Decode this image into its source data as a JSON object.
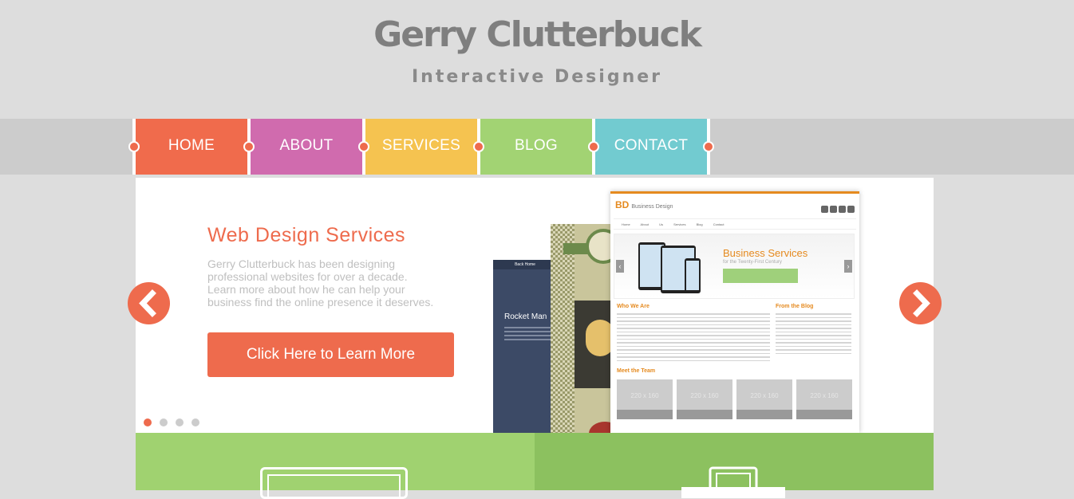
{
  "header": {
    "title": "Gerry Clutterbuck",
    "subtitle": "Interactive Designer"
  },
  "nav": {
    "items": [
      {
        "label": "HOME",
        "color": "#f06b4c"
      },
      {
        "label": "ABOUT",
        "color": "#d06bae"
      },
      {
        "label": "SERVICES",
        "color": "#f5c350"
      },
      {
        "label": "BLOG",
        "color": "#a2d373"
      },
      {
        "label": "CONTACT",
        "color": "#72cbd0"
      }
    ]
  },
  "slider": {
    "heading": "Web Design Services",
    "text": "Gerry Clutterbuck has been designing professional websites for over a decade. Learn more about how he can help your business find the online presence it deserves.",
    "cta_label": "Click Here to Learn More",
    "slide_count": 4,
    "active_slide": 1,
    "prev_icon": "chevron-left-icon",
    "next_icon": "chevron-right-icon",
    "mockup": {
      "left_header": "Back Home",
      "left_title": "Rocket Man",
      "site_logo": "BD",
      "site_name": "Business Design",
      "site_nav": "Home About Us Services Blog Contact",
      "banner_title": "Business Services",
      "banner_subtitle": "for the Twenty-First Century",
      "who_we_are": "Who We Are",
      "from_the_blog": "From the Blog",
      "meet_the_team": "Meet the Team",
      "team_placeholder": "220 x 160"
    }
  },
  "colors": {
    "accent": "#ee6b4d",
    "background": "#dddddd",
    "feature_left": "#a0d270",
    "feature_right": "#8cc15f"
  }
}
